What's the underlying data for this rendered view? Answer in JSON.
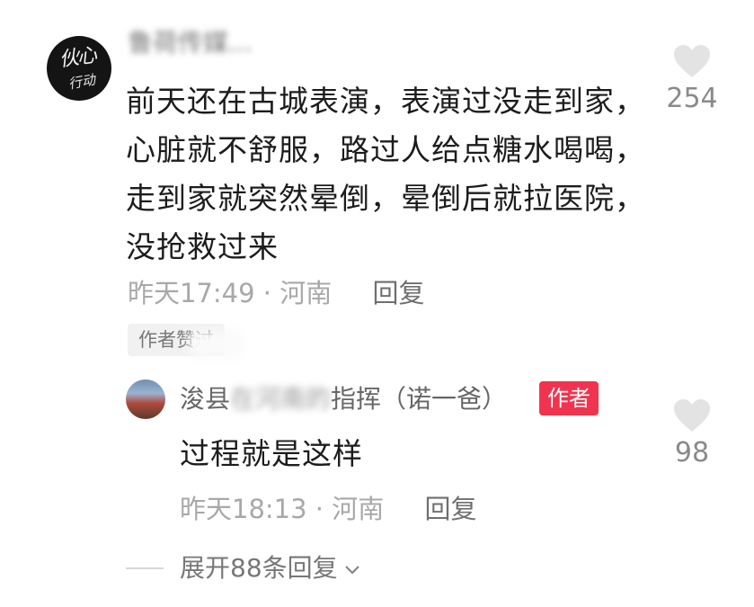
{
  "comment": {
    "username": "鲁荷传媒...",
    "avatar_text": "伙心",
    "avatar_sub": "行动",
    "text": "前天还在古城表演，表演过没走到家，心脏就不舒服，路过人给点糖水喝喝，走到家就突然晕倒，晕倒后就拉医院，没抢救过来",
    "time": "昨天17:49 · 河南",
    "reply_label": "回复",
    "author_liked": "作者赞过",
    "likes": "254"
  },
  "reply": {
    "username_prefix": "浚县",
    "username_blurred": "在河南的",
    "username_suffix": "指挥（诺一爸）",
    "author_badge": "作者",
    "text": "过程就是这样",
    "time": "昨天18:13 · 河南",
    "reply_label": "回复",
    "likes": "98"
  },
  "expand": {
    "label": "展开88条回复"
  },
  "colors": {
    "badge": "#f0344f",
    "text": "#1c1c1c",
    "meta": "#a8a8a8",
    "heart": "#e3e3e3"
  }
}
